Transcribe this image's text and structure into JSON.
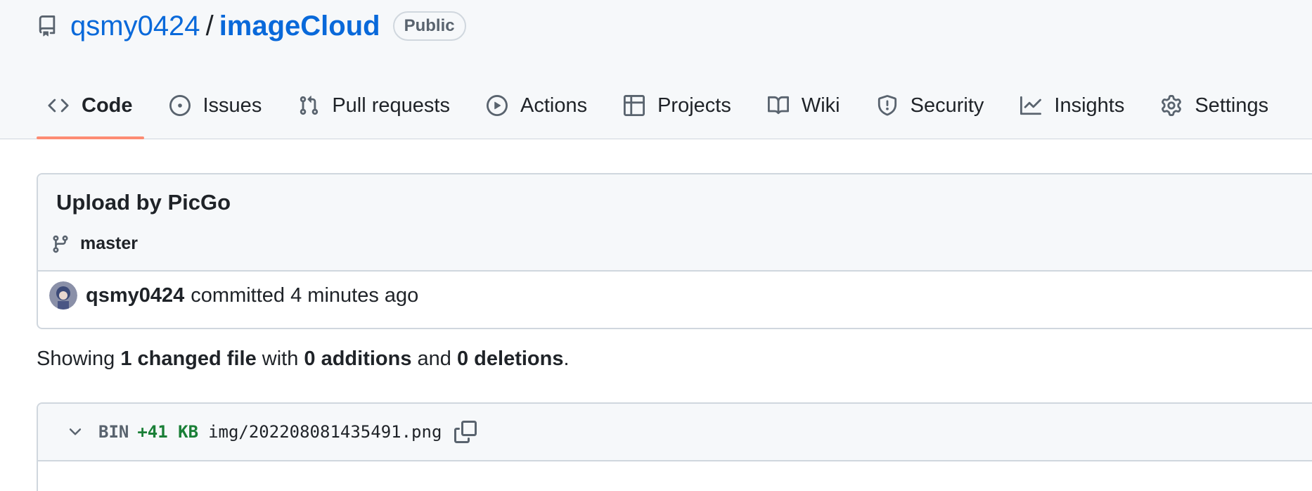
{
  "repo": {
    "owner": "qsmy0424",
    "separator": "/",
    "name": "imageCloud",
    "visibility": "Public"
  },
  "tabs": [
    {
      "label": "Code",
      "icon": "code-icon",
      "selected": true
    },
    {
      "label": "Issues",
      "icon": "issue-icon"
    },
    {
      "label": "Pull requests",
      "icon": "pull-request-icon"
    },
    {
      "label": "Actions",
      "icon": "play-icon"
    },
    {
      "label": "Projects",
      "icon": "table-icon"
    },
    {
      "label": "Wiki",
      "icon": "book-icon"
    },
    {
      "label": "Security",
      "icon": "shield-icon"
    },
    {
      "label": "Insights",
      "icon": "graph-icon"
    },
    {
      "label": "Settings",
      "icon": "gear-icon"
    }
  ],
  "commit": {
    "title": "Upload by PicGo",
    "branch": "master",
    "author": "qsmy0424",
    "action": "committed",
    "time": "4 minutes ago"
  },
  "summary": {
    "prefix": "Showing",
    "changed": "1 changed file",
    "with": "with",
    "additions": "0 additions",
    "and": "and",
    "deletions": "0 deletions",
    "period": "."
  },
  "file": {
    "type": "BIN",
    "size_change": "+41 KB",
    "path": "img/202208081435491.png"
  },
  "colors": {
    "link": "#0969da",
    "selected_tab_underline": "#fd8c73",
    "addition": "#1a7f37",
    "border": "#d0d7de",
    "header_bg": "#f6f8fa"
  }
}
